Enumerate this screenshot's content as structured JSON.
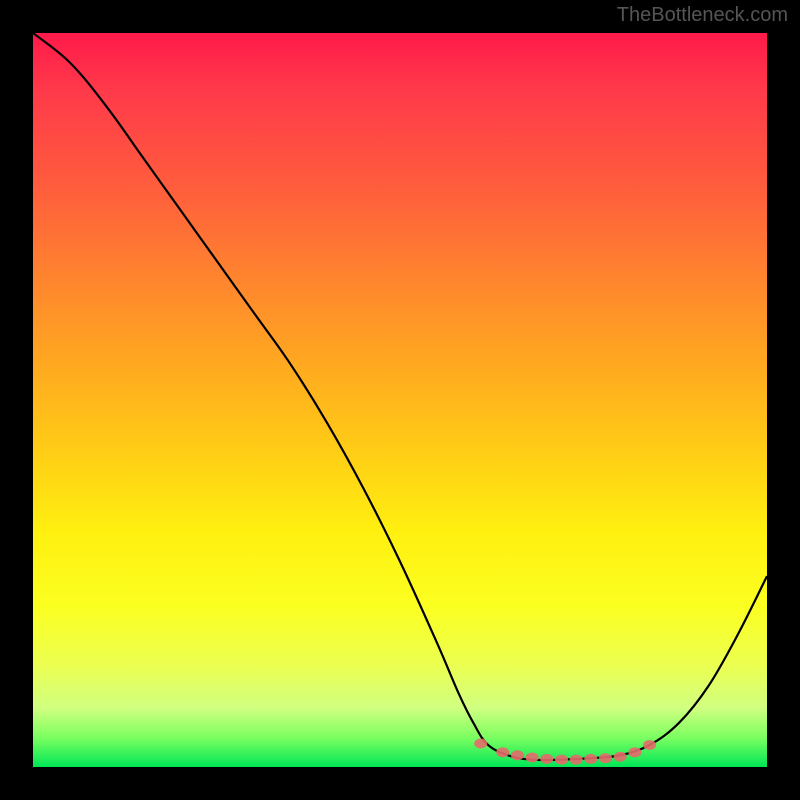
{
  "watermark": "TheBottleneck.com",
  "chart_data": {
    "type": "line",
    "title": "",
    "xlabel": "",
    "ylabel": "",
    "xlim": [
      0,
      100
    ],
    "ylim": [
      0,
      100
    ],
    "series": [
      {
        "name": "bottleneck-curve",
        "x": [
          0,
          5,
          10,
          15,
          20,
          25,
          30,
          35,
          40,
          45,
          50,
          55,
          58,
          60,
          62,
          65,
          68,
          72,
          76,
          80,
          84,
          88,
          92,
          96,
          100
        ],
        "y": [
          100,
          96,
          90,
          83,
          76,
          69,
          62,
          55,
          47,
          38,
          28,
          17,
          10,
          6,
          3,
          1.5,
          1,
          1,
          1.2,
          1.6,
          3,
          6,
          11,
          18,
          26
        ]
      }
    ],
    "markers": {
      "name": "highlight-segment",
      "x": [
        61,
        64,
        66,
        68,
        70,
        72,
        74,
        76,
        78,
        80,
        82,
        84
      ],
      "y": [
        3.2,
        2.0,
        1.6,
        1.3,
        1.1,
        1.0,
        1.0,
        1.1,
        1.2,
        1.4,
        2.0,
        3.0
      ],
      "color": "#e66a6a"
    },
    "background_gradient": {
      "top": "#ff1a4a",
      "bottom": "#00e656"
    },
    "grid": false,
    "legend": false
  }
}
